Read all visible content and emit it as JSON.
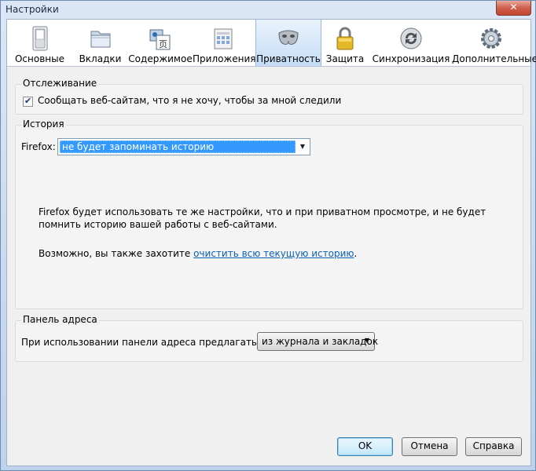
{
  "window": {
    "title": "Настройки",
    "close_glyph": "✕"
  },
  "tabs": [
    {
      "label": "Основные",
      "icon": "switch-icon"
    },
    {
      "label": "Вкладки",
      "icon": "tabs-folder-icon"
    },
    {
      "label": "Содержимое",
      "icon": "content-icon"
    },
    {
      "label": "Приложения",
      "icon": "applications-icon"
    },
    {
      "label": "Приватность",
      "icon": "mask-icon"
    },
    {
      "label": "Защита",
      "icon": "padlock-icon"
    },
    {
      "label": "Синхронизация",
      "icon": "sync-icon"
    },
    {
      "label": "Дополнительные",
      "icon": "gear-icon"
    }
  ],
  "tracking": {
    "caption": "Отслеживание",
    "checkbox_label": "Сообщать веб-сайтам, что я не хочу, чтобы за мной следили",
    "checked": true
  },
  "history": {
    "caption": "История",
    "firefox_label": "Firefox:",
    "mode_value": "не будет запоминать историю",
    "description": "Firefox будет использовать те же настройки, что и при приватном просмотре, и не будет помнить историю вашей работы с веб-сайтами.",
    "maybe_text": "Возможно, вы также захотите ",
    "clear_link": "очистить всю текущую историю",
    "period": "."
  },
  "address_bar": {
    "caption": "Панель адреса",
    "suggest_label": "При использовании панели адреса предлагать ссылки:",
    "suggest_value": "из журнала и закладок"
  },
  "buttons": {
    "ok": "OK",
    "cancel": "Отмена",
    "help": "Справка"
  }
}
